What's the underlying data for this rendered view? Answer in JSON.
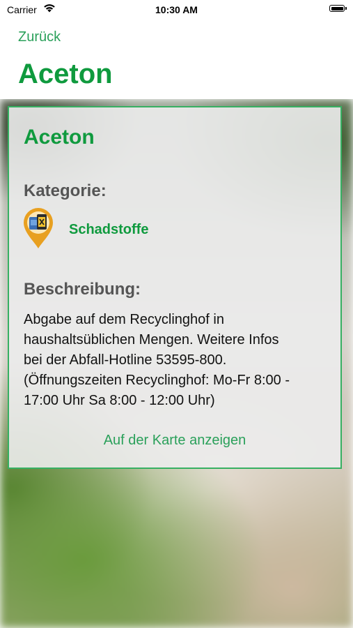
{
  "status_bar": {
    "carrier": "Carrier",
    "time": "10:30 AM"
  },
  "nav": {
    "back_label": "Zurück",
    "title": "Aceton"
  },
  "card": {
    "title": "Aceton",
    "category_label": "Kategorie:",
    "category_name": "Schadstoffe",
    "category_icon": "hazardous-waste-pin-icon",
    "description_label": "Beschreibung:",
    "description_lines": [
      "Abgabe auf dem Recyclinghof in",
      "haushaltsüblichen Mengen. Weitere Infos",
      "bei der Abfall-Hotline 53595-800.",
      "(Öffnungszeiten Recyclinghof: Mo-Fr 8:00 -",
      "17:00 Uhr Sa 8:00 - 12:00 Uhr)"
    ],
    "map_link": "Auf der Karte anzeigen"
  },
  "colors": {
    "accent": "#0f9a3e",
    "link": "#2aa05a",
    "border": "#36b062",
    "pin": "#e8a020"
  }
}
